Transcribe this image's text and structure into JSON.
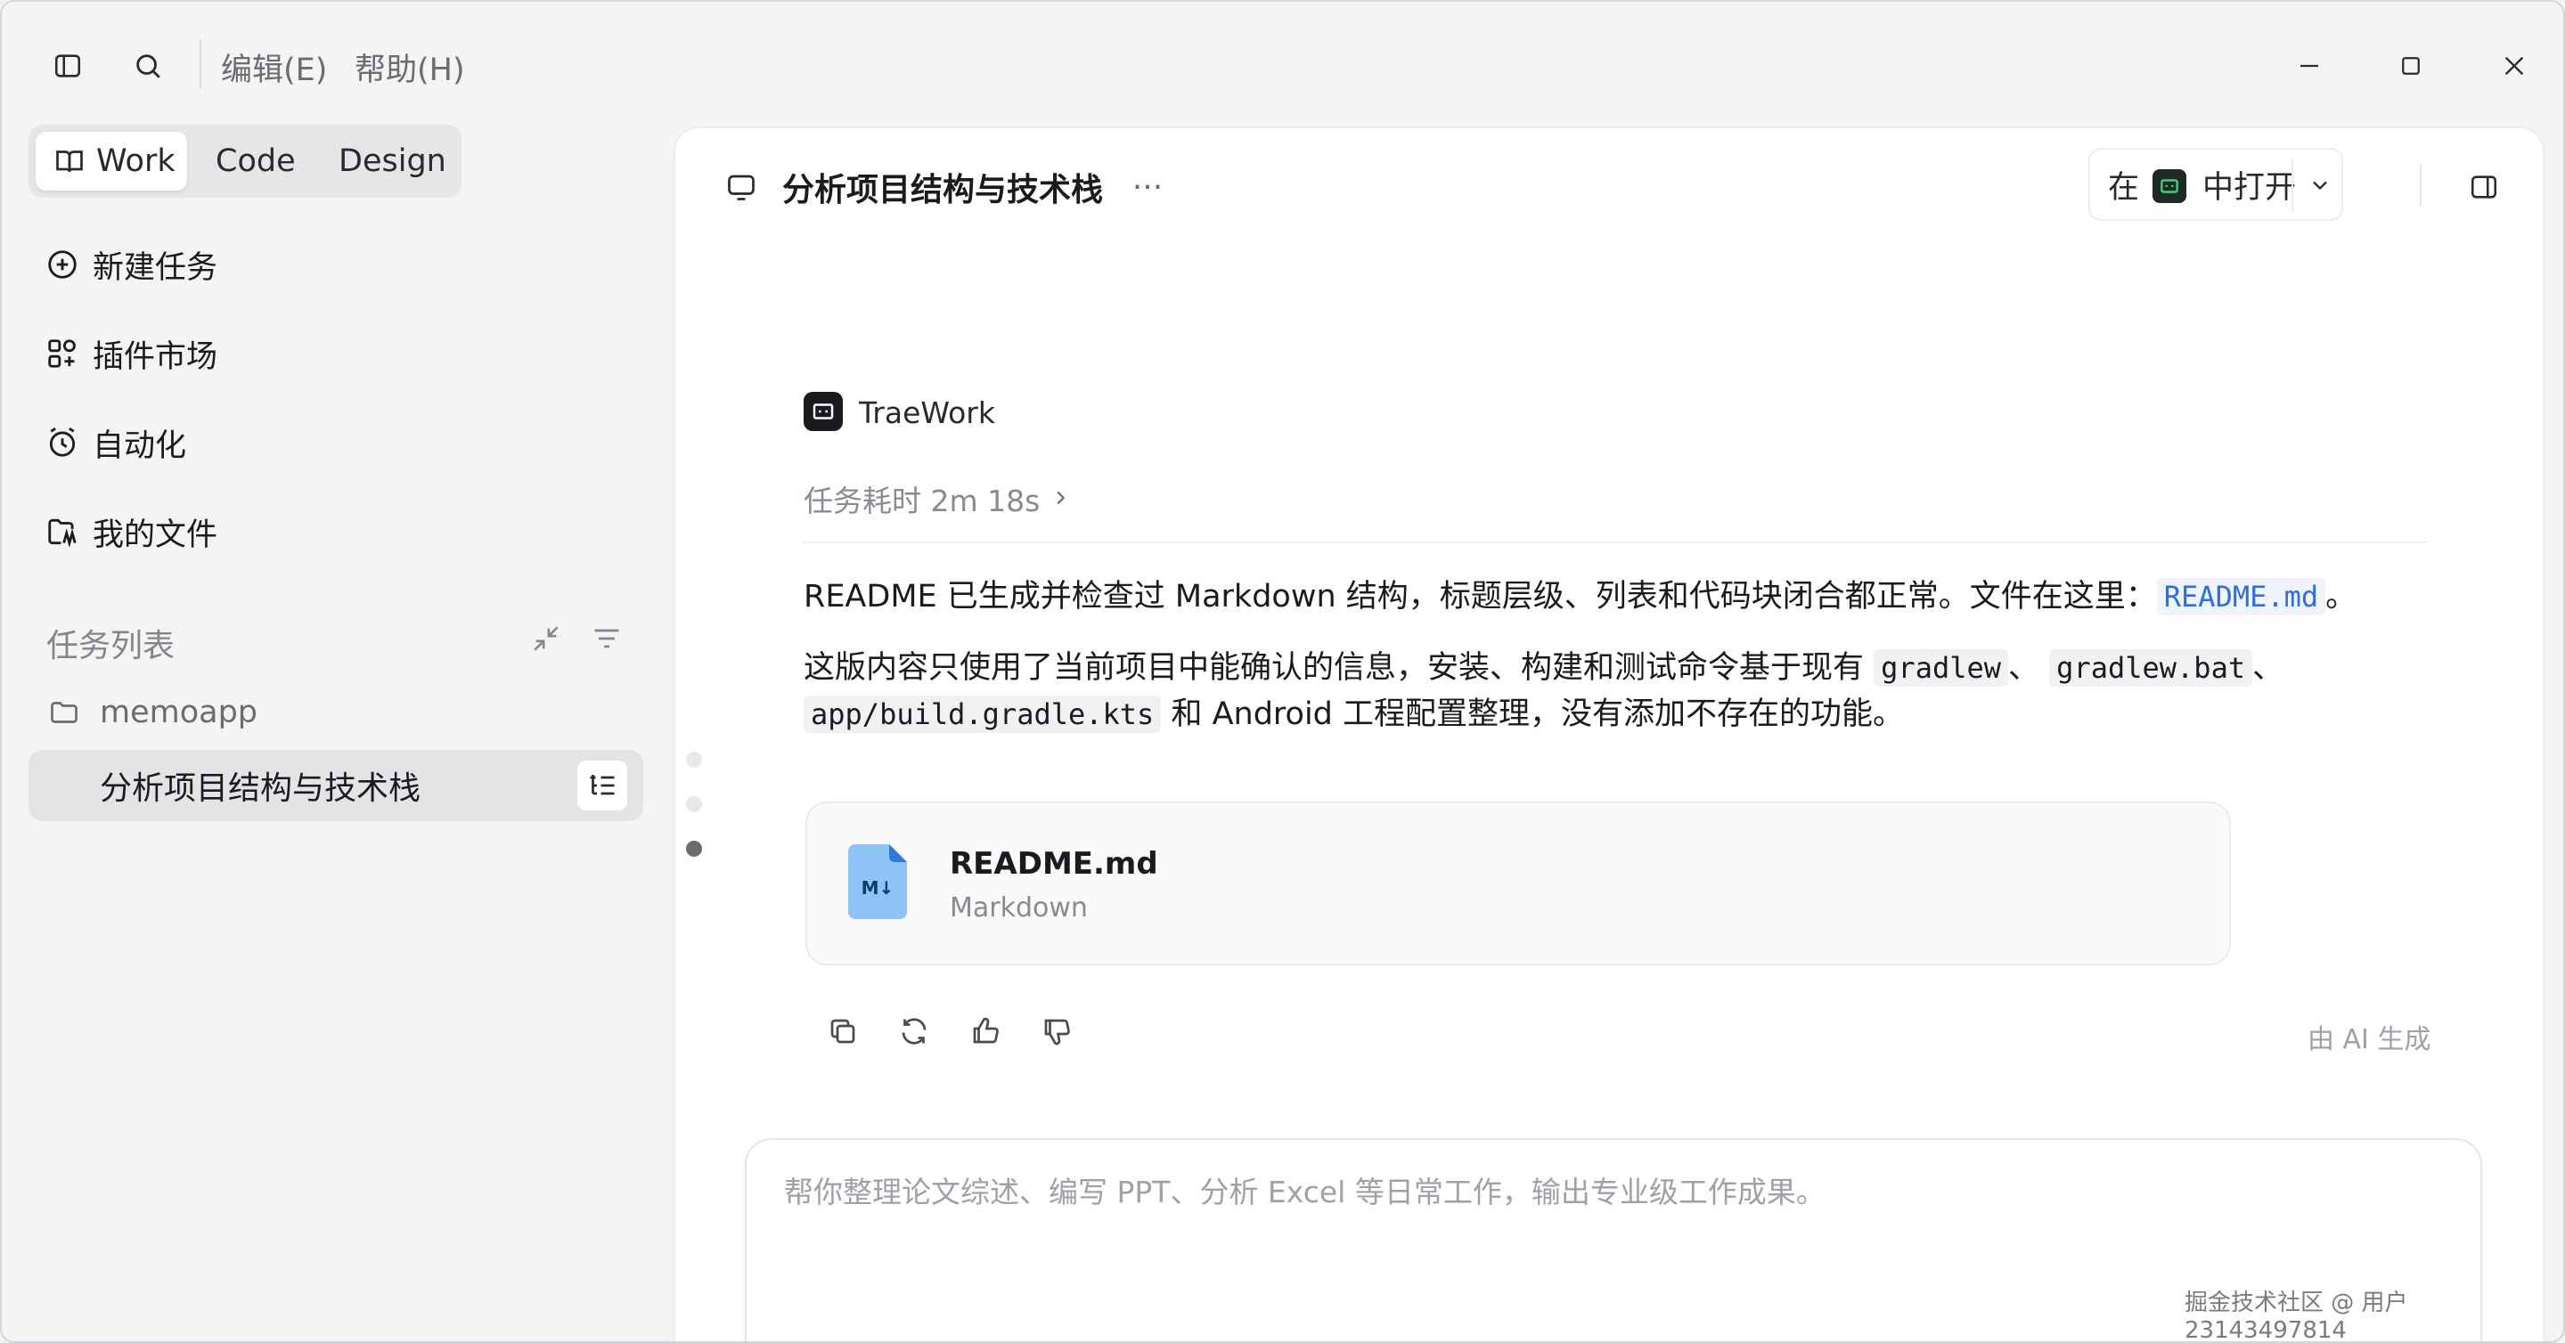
{
  "titlebar": {
    "menus": [
      "编辑(E)",
      "帮助(H)"
    ]
  },
  "sidebar": {
    "modes": [
      {
        "label": "Work",
        "active": true
      },
      {
        "label": "Code",
        "active": false
      },
      {
        "label": "Design",
        "active": false
      }
    ],
    "nav": [
      {
        "label": "新建任务",
        "icon": "plus-circle-icon"
      },
      {
        "label": "插件市场",
        "icon": "plugin-grid-icon"
      },
      {
        "label": "自动化",
        "icon": "alarm-clock-icon"
      },
      {
        "label": "我的文件",
        "icon": "folder-icon"
      }
    ],
    "section_title": "任务列表",
    "project": "memoapp",
    "task": "分析项目结构与技术栈"
  },
  "main": {
    "title": "分析项目结构与技术栈",
    "more": "···",
    "open_in": {
      "pre": "在",
      "post": "中打开"
    },
    "agent_name": "TraeWork",
    "duration": "任务耗时 2m 18s",
    "message": {
      "p1_text": "README 已生成并检查过 Markdown 结构，标题层级、列表和代码块闭合都正常。文件在这里：",
      "p1_link": "README.md",
      "p1_end": "。",
      "p2_a": "这版内容只使用了当前项目中能确认的信息，安装、构建和测试命令基于现有",
      "p2_code1": "gradlew",
      "p2_sep1": "、",
      "p2_code2": "gradlew.bat",
      "p2_sep2": "、",
      "p2_code3": "app/build.gradle.kts",
      "p2_b": "和 Android 工程配置整理，没有添加不存在的功能。"
    },
    "file": {
      "name": "README.md",
      "type": "Markdown",
      "badge": "M↓"
    },
    "ai_generated": "由 AI 生成",
    "composer_placeholder": "帮你整理论文综述、编写 PPT、分析 Excel 等日常工作，输出专业级工作成果。"
  },
  "watermark": "掘金技术社区 @ 用户23143497814",
  "colors": {
    "accent_link": "#2f6fd6",
    "file_icon": "#8ec3f5",
    "send_button": "#5b48d6"
  }
}
